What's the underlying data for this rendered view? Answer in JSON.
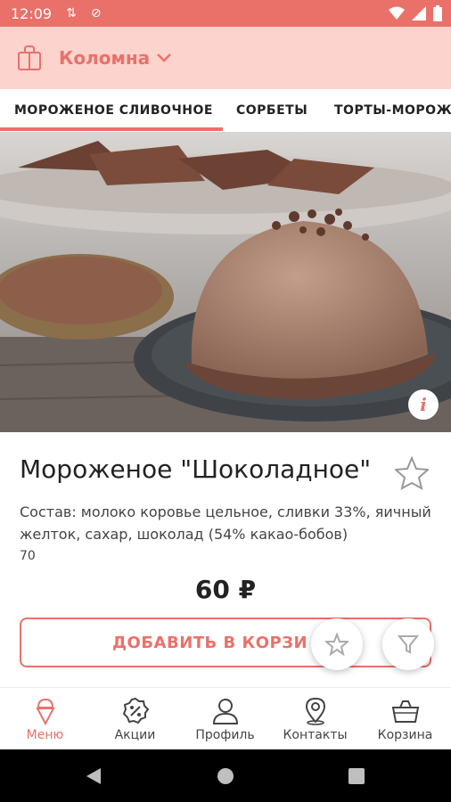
{
  "status_bar": {
    "time": "12:09"
  },
  "header": {
    "city": "Коломна"
  },
  "tabs": [
    {
      "label": "МОРОЖЕНОЕ СЛИВОЧНОЕ",
      "active": true
    },
    {
      "label": "СОРБЕТЫ",
      "active": false
    },
    {
      "label": "ТОРТЫ-МОРОЖЕ",
      "active": false
    }
  ],
  "product": {
    "title": "Мороженое \"Шоколадное\"",
    "description": "Состав: молоко коровье цельное, сливки 33%, яичный желток, сахар, шоколад (54% какао-бобов)",
    "weight": "70",
    "price": "60 ₽",
    "add_button": "ДОБАВИТЬ В КОРЗИ",
    "info_glyph": "i"
  },
  "bottom_nav": [
    {
      "label": "Меню",
      "icon": "ice-cream-icon",
      "active": true
    },
    {
      "label": "Акции",
      "icon": "percent-badge-icon",
      "active": false
    },
    {
      "label": "Профиль",
      "icon": "user-icon",
      "active": false
    },
    {
      "label": "Контакты",
      "icon": "location-pin-icon",
      "active": false
    },
    {
      "label": "Корзина",
      "icon": "basket-icon",
      "active": false
    }
  ],
  "colors": {
    "accent": "#e9716a",
    "header_bg": "#fdd3cd",
    "status_bg": "#e9716a"
  }
}
